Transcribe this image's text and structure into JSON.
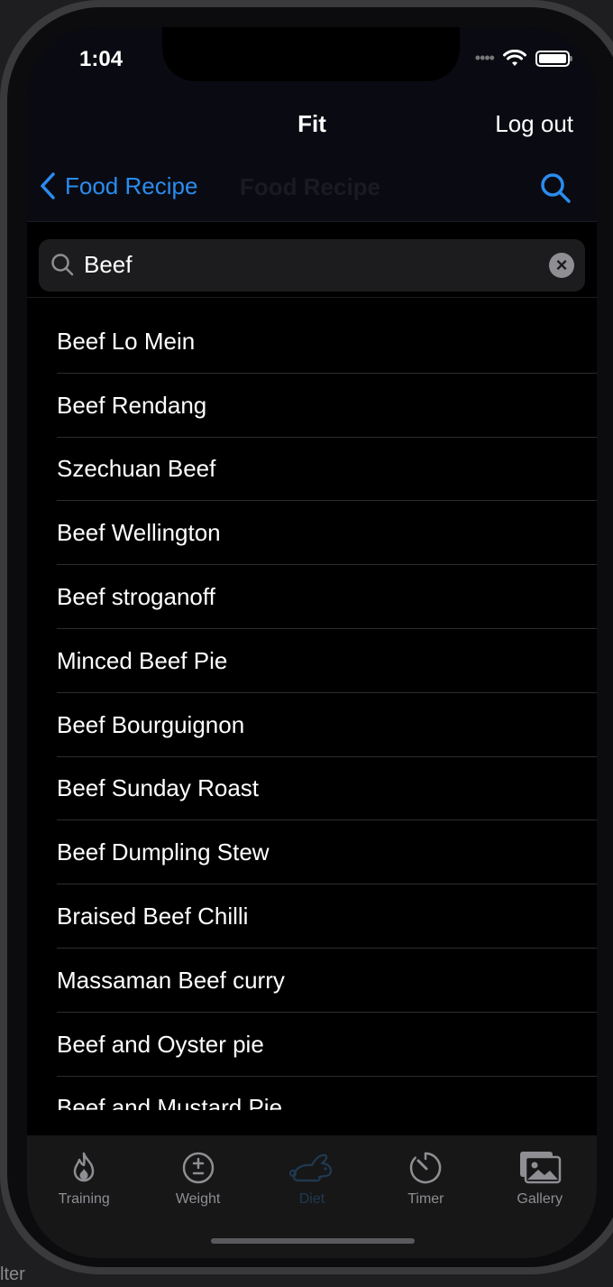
{
  "status_bar": {
    "time": "1:04"
  },
  "header": {
    "title": "Fit",
    "logout_label": "Log out"
  },
  "nav": {
    "back_label": "Food Recipe",
    "ghost_title": "Food Recipe"
  },
  "search": {
    "value": "Beef"
  },
  "recipes": [
    "Beef Lo Mein",
    "Beef Rendang",
    "Szechuan Beef",
    "Beef Wellington",
    "Beef stroganoff",
    "Minced Beef Pie",
    "Beef Bourguignon",
    "Beef Sunday Roast",
    "Beef Dumpling Stew",
    "Braised Beef Chilli",
    "Massaman Beef curry",
    "Beef and Oyster pie",
    "Beef and Mustard Pie"
  ],
  "tabs": [
    {
      "label": "Training",
      "icon": "flame-icon"
    },
    {
      "label": "Weight",
      "icon": "plus-minus-icon"
    },
    {
      "label": "Diet",
      "icon": "rabbit-icon"
    },
    {
      "label": "Timer",
      "icon": "timer-icon"
    },
    {
      "label": "Gallery",
      "icon": "photos-icon"
    }
  ],
  "background": {
    "filter_label": "lter"
  },
  "colors": {
    "accent": "#2a8cf0",
    "active_tab": "#1f3a52"
  }
}
